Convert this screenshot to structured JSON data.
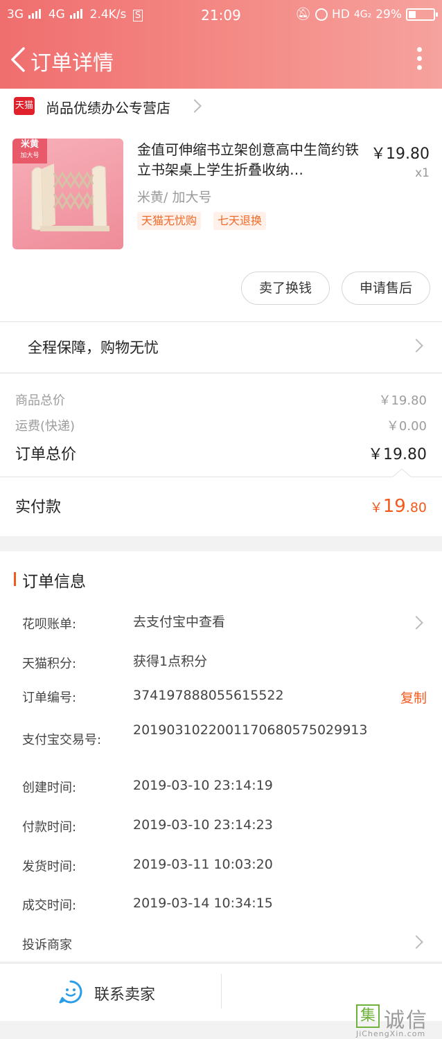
{
  "status_bar": {
    "network_left": "3G",
    "network_right": "4G",
    "speed": "2.4K/s",
    "sim_icon_label": "S",
    "time": "21:09",
    "hd": "HD",
    "net_type": "4G₂",
    "battery": "29%"
  },
  "nav": {
    "title": "订单详情"
  },
  "store": {
    "badge": "天猫",
    "name": "尚品优绩办公专营店"
  },
  "product": {
    "thumb_tag_1": "米黄",
    "thumb_tag_2": "加大号",
    "title": "金值可伸缩书立架创意高中生简约铁立书架桌上学生折叠收纳…",
    "price": "￥19.80",
    "qty": "x1",
    "sku": "米黄/ 加大号",
    "tags": [
      "天猫无忧购",
      "七天退换"
    ]
  },
  "actions": {
    "sell": "卖了换钱",
    "after_sale": "申请售后"
  },
  "assurance": "全程保障，购物无忧",
  "summary": {
    "goods_label": "商品总价",
    "goods_value": "￥19.80",
    "shipping_label": "运费(快递)",
    "shipping_value": "￥0.00",
    "total_label": "订单总价",
    "total_value": "￥19.80",
    "paid_label": "实付款",
    "paid_currency": "￥",
    "paid_int": "19",
    "paid_dec": ".80"
  },
  "info": {
    "title": "订单信息",
    "huabei_label": "花呗账单:",
    "huabei_value": "去支付宝中查看",
    "points_label": "天猫积分:",
    "points_value": "获得1点积分",
    "order_no_label": "订单编号:",
    "order_no_value": "374197888055615522",
    "copy": "复制",
    "alipay_label": "支付宝交易号:",
    "alipay_value": "2019031022001170680575029913",
    "created_label": "创建时间:",
    "created_value": "2019-03-10 23:14:19",
    "paid_label": "付款时间:",
    "paid_value": "2019-03-10 23:14:23",
    "shipped_label": "发货时间:",
    "shipped_value": "2019-03-11 10:03:20",
    "closed_label": "成交时间:",
    "closed_value": "2019-03-14 10:34:15",
    "complain": "投诉商家"
  },
  "bottom": {
    "contact": "联系卖家"
  },
  "watermark": {
    "box": "集",
    "text": "诚信",
    "url": "JiChengXin.com"
  },
  "colors": {
    "accent_orange": "#f25a1c",
    "header_gradient_start": "#ef6e6e",
    "header_gradient_end": "#f6a29e",
    "tmall_red": "#e0202a"
  }
}
